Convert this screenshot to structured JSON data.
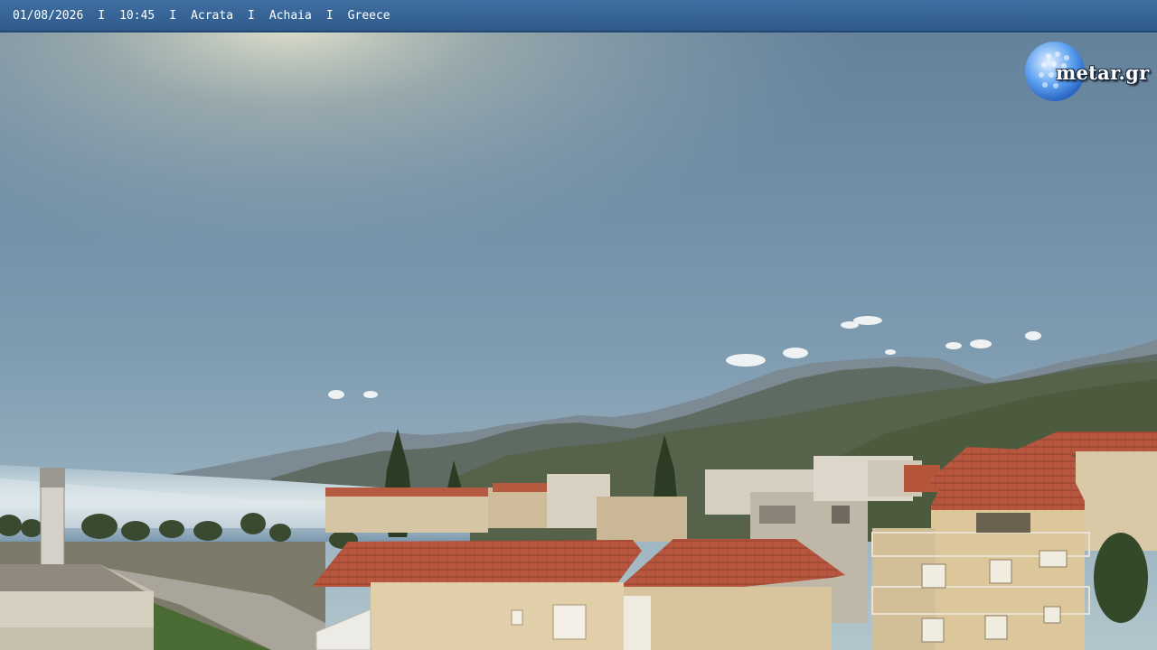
{
  "overlay": {
    "date": "01/08/2026",
    "time": "10:45",
    "location": "Acrata",
    "region": "Achaia",
    "country": "Greece",
    "separator": "I"
  },
  "logo": {
    "text": "metar.gr"
  },
  "colors": {
    "bar": "#2f5b8c",
    "sky_top": "#6d8aa2",
    "sky_bottom": "#a9bdc6",
    "sea": "#6f8fa8",
    "roof": "#b5553a",
    "wall": "#d9c79f"
  }
}
